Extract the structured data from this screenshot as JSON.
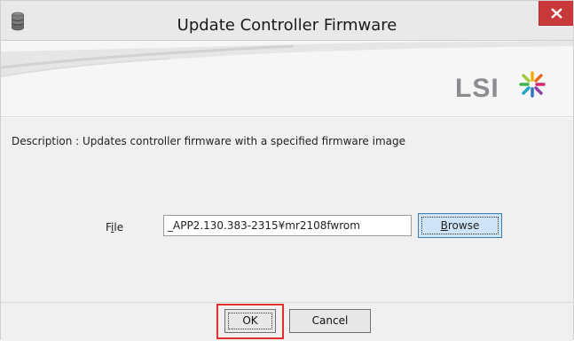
{
  "window": {
    "title": "Update Controller Firmware",
    "app_icon": "database-icon",
    "close_icon": "close-icon"
  },
  "banner": {
    "logo_text": "LSI",
    "logo_icon": "lsi-starburst-icon"
  },
  "content": {
    "description": "Description : Updates controller firmware with a specified firmware image",
    "file_label_prefix": "F",
    "file_label_mnemonic": "i",
    "file_label_suffix": "le",
    "file_value": "_APP2.130.383-2315¥mr2108fwrom",
    "browse_label_mnemonic": "B",
    "browse_label_rest": "rowse"
  },
  "footer": {
    "ok_label": "OK",
    "cancel_label": "Cancel"
  },
  "colors": {
    "close": "#c9383a",
    "highlight": "#e03030",
    "browse_bg": "#cfe4f7",
    "browse_border": "#3c7fb1"
  }
}
